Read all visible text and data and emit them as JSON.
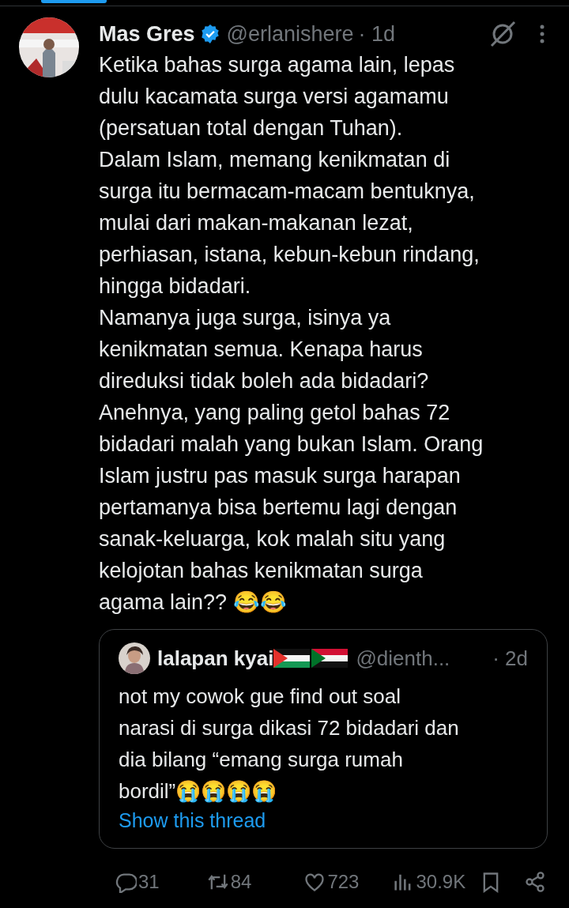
{
  "post": {
    "author": "Mas Gres",
    "verified": true,
    "handle": "@erlanishere",
    "time": "· 1d",
    "text_lines": [
      "Ketika bahas surga agama lain, lepas",
      "dulu kacamata surga versi agamamu",
      "(persatuan total dengan Tuhan).",
      "Dalam Islam, memang kenikmatan di",
      "surga itu bermacam-macam bentuknya,",
      "mulai dari makan-makanan lezat,",
      "perhiasan, istana, kebun-kebun rindang,",
      "hingga bidadari.",
      "Namanya juga surga, isinya ya",
      "kenikmatan semua. Kenapa harus",
      "direduksi tidak boleh ada bidadari?",
      "Anehnya, yang paling getol bahas 72",
      "bidadari malah yang bukan Islam. Orang",
      "Islam justru pas masuk surga harapan",
      "pertamanya bisa bertemu lagi dengan",
      "sanak-keluarga, kok malah situ yang",
      "kelojotan bahas kenikmatan surga",
      "agama lain?? 😂😂"
    ],
    "quote": {
      "author": "lalapan kyai",
      "handle": "@dienth...",
      "time": "· 2d",
      "text_lines": [
        "not my cowok gue find out soal",
        "narasi di surga dikasi 72 bidadari dan",
        "dia bilang “emang surga rumah",
        "bordil”😭😭😭😭"
      ],
      "link": "Show this thread"
    },
    "actions": [
      {
        "kind": "reply",
        "count": "31"
      },
      {
        "kind": "repost",
        "count": "84"
      },
      {
        "kind": "like",
        "count": "723"
      },
      {
        "kind": "views",
        "count": "30.9K"
      },
      {
        "kind": "bookmark"
      },
      {
        "kind": "share"
      }
    ]
  }
}
